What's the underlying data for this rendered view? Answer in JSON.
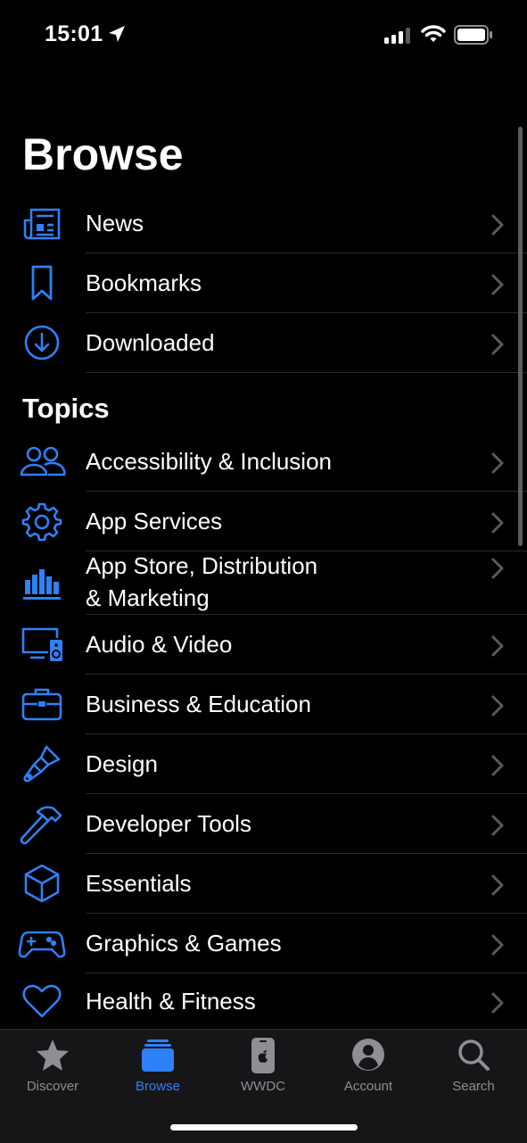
{
  "status_bar": {
    "time": "15:01"
  },
  "page": {
    "title": "Browse"
  },
  "library": [
    {
      "label": "News",
      "icon": "newspaper-icon"
    },
    {
      "label": "Bookmarks",
      "icon": "bookmark-icon"
    },
    {
      "label": "Downloaded",
      "icon": "download-circle-icon"
    }
  ],
  "topics_header": "Topics",
  "topics": [
    {
      "label": "Accessibility & Inclusion",
      "icon": "people-icon"
    },
    {
      "label": "App Services",
      "icon": "gear-icon"
    },
    {
      "label_line1": "App Store, Distribution",
      "label_line2": "& Marketing",
      "icon": "chart-bars-icon"
    },
    {
      "label": "Audio & Video",
      "icon": "display-speaker-icon"
    },
    {
      "label": "Business & Education",
      "icon": "briefcase-icon"
    },
    {
      "label": "Design",
      "icon": "paintbrush-icon"
    },
    {
      "label": "Developer Tools",
      "icon": "hammer-icon"
    },
    {
      "label": "Essentials",
      "icon": "cube-icon"
    },
    {
      "label": "Graphics & Games",
      "icon": "game-controller-icon"
    },
    {
      "label": "Health & Fitness",
      "icon": "heart-icon"
    }
  ],
  "tab_bar": [
    {
      "label": "Discover",
      "icon": "star-icon",
      "active": false
    },
    {
      "label": "Browse",
      "icon": "stack-icon",
      "active": true
    },
    {
      "label": "WWDC",
      "icon": "phone-apple-icon",
      "active": false
    },
    {
      "label": "Account",
      "icon": "person-circle-icon",
      "active": false
    },
    {
      "label": "Search",
      "icon": "search-icon",
      "active": false
    }
  ],
  "colors": {
    "accent": "#2f81f7",
    "background": "#000000",
    "separator": "#2a2a2c",
    "chevron": "#5a5a5e",
    "tab_inactive": "#8e8e93"
  }
}
